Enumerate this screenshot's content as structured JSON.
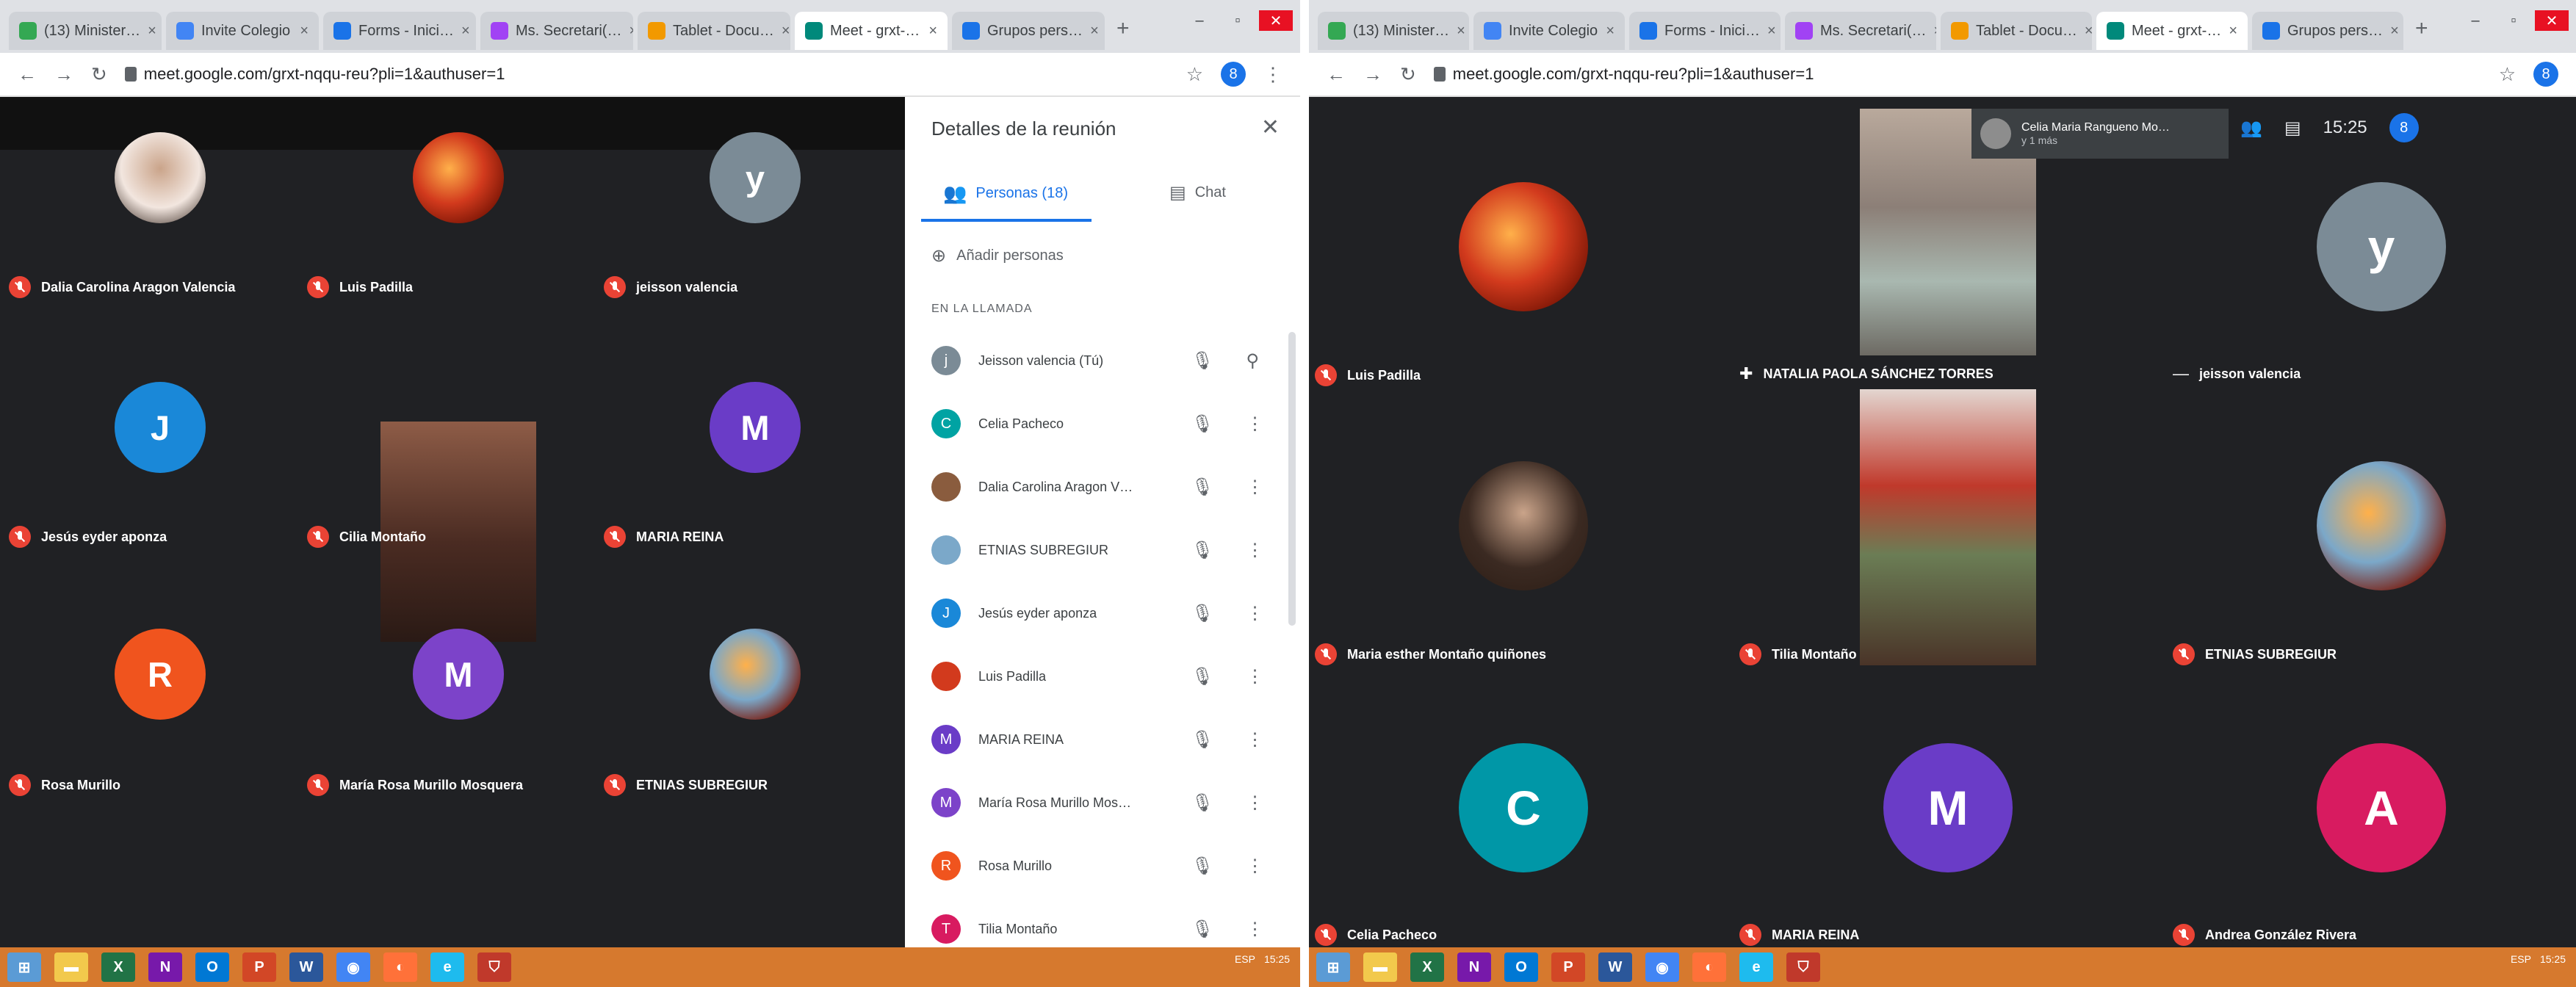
{
  "left": {
    "tabs": [
      {
        "label": "(13) Minister…",
        "color": "#34a853"
      },
      {
        "label": "Invite Colegio",
        "color": "#4285f4"
      },
      {
        "label": "Forms - Inici…",
        "color": "#1a73e8"
      },
      {
        "label": "Ms. Secretari(…",
        "color": "#a142f4"
      },
      {
        "label": "Tablet - Docu…",
        "color": "#f29900"
      },
      {
        "label": "Meet - grxt-…",
        "color": "#00897b"
      },
      {
        "label": "Grupos pers…",
        "color": "#1a73e8"
      }
    ],
    "url": "meet.google.com/grxt-nqqu-reu?pli=1&authuser=1",
    "account_initial": "8",
    "participants": [
      {
        "name": "Dalia Carolina Aragon Valencia",
        "type": "photo",
        "color": "#f2e6df"
      },
      {
        "name": "Luis Padilla",
        "type": "image",
        "color": "#d23a1d"
      },
      {
        "name": "jeisson valencia",
        "type": "letter",
        "letter": "y",
        "color": "#7b8b96"
      },
      {
        "name": "Jesús eyder aponza",
        "type": "letter",
        "letter": "J",
        "color": "#1a88d8"
      },
      {
        "name": "Cilia Montaño",
        "type": "video",
        "color": "#6b3c2e"
      },
      {
        "name": "MARIA REINA",
        "type": "letter",
        "letter": "M",
        "color": "#6a3cc7"
      },
      {
        "name": "Rosa Murillo",
        "type": "letter",
        "letter": "R",
        "color": "#f0541e"
      },
      {
        "name": "María Rosa Murillo Mosquera",
        "type": "letter",
        "letter": "M",
        "color": "#7c43c9"
      },
      {
        "name": "ETNIAS SUBREGIUR",
        "type": "image",
        "color": "#7ba8c9"
      }
    ],
    "panel": {
      "title": "Detalles de la reunión",
      "tab_people": "Personas (18)",
      "tab_chat": "Chat",
      "add_people": "Añadir personas",
      "section": "EN LA LLAMADA",
      "list": [
        {
          "name": "Jeisson valencia (Tú)",
          "letter": "j",
          "color": "#7b8b96"
        },
        {
          "name": "Celia Pacheco",
          "letter": "C",
          "color": "#00a3a3"
        },
        {
          "name": "Dalia Carolina Aragon V…",
          "letter": "",
          "color": "#8a5c3e"
        },
        {
          "name": "ETNIAS SUBREGIUR",
          "letter": "",
          "color": "#7ba8c9"
        },
        {
          "name": "Jesús eyder aponza",
          "letter": "J",
          "color": "#1a88d8"
        },
        {
          "name": "Luis Padilla",
          "letter": "",
          "color": "#d23a1d"
        },
        {
          "name": "MARIA REINA",
          "letter": "M",
          "color": "#6a3cc7"
        },
        {
          "name": "María Rosa Murillo Mos…",
          "letter": "M",
          "color": "#7c43c9"
        },
        {
          "name": "Rosa Murillo",
          "letter": "R",
          "color": "#f0541e"
        },
        {
          "name": "Tilia Montaño",
          "letter": "T",
          "color": "#d81b60"
        }
      ]
    },
    "tray_time": "15:25",
    "tray_lang": "ESP"
  },
  "right": {
    "tabs": [
      {
        "label": "(13) Minister…",
        "color": "#34a853"
      },
      {
        "label": "Invite Colegio",
        "color": "#4285f4"
      },
      {
        "label": "Forms - Inici…",
        "color": "#1a73e8"
      },
      {
        "label": "Ms. Secretari(…",
        "color": "#a142f4"
      },
      {
        "label": "Tablet - Docu…",
        "color": "#f29900"
      },
      {
        "label": "Meet - grxt-…",
        "color": "#00897b"
      },
      {
        "label": "Grupos pers…",
        "color": "#1a73e8"
      }
    ],
    "url": "meet.google.com/grxt-nqqu-reu?pli=1&authuser=1",
    "account_initial": "8",
    "presenter": {
      "name": "Celia Maria Rangueno Mo…",
      "sub": "y 1 más"
    },
    "time": "15:25",
    "participants": [
      {
        "name": "Luis Padilla",
        "type": "image",
        "color": "#d23a1d"
      },
      {
        "name": "NATALIA PAOLA SÁNCHEZ TORRES",
        "type": "video",
        "color": "#9b8f86"
      },
      {
        "name": "jeisson valencia",
        "type": "letter",
        "letter": "y",
        "color": "#7b8b96"
      },
      {
        "name": "Maria esther Montaño quiñones",
        "type": "photo",
        "color": "#3b2a22"
      },
      {
        "name": "Tilia Montaño",
        "type": "video",
        "color": "#b43a2d"
      },
      {
        "name": "ETNIAS SUBREGIUR",
        "type": "image",
        "color": "#7ba8c9"
      },
      {
        "name": "Celia Pacheco",
        "type": "letter",
        "letter": "C",
        "color": "#0097a7"
      },
      {
        "name": "MARIA REINA",
        "type": "letter",
        "letter": "M",
        "color": "#6a3cc7"
      },
      {
        "name": "Andrea González Rivera",
        "type": "letter",
        "letter": "A",
        "color": "#d81b60"
      }
    ],
    "tray_time": "15:25",
    "tray_lang": "ESP"
  },
  "icons": {
    "back": "back-arrow-icon",
    "forward": "forward-arrow-icon",
    "reload": "reload-icon",
    "mic_off": "mic-off-icon",
    "pin": "pin-icon",
    "more": "more-vert-icon"
  },
  "colors": {
    "meet_bg": "#202124",
    "taskbar": "#d6792e",
    "accent": "#1a73e8",
    "mic_off": "#ea4335"
  }
}
